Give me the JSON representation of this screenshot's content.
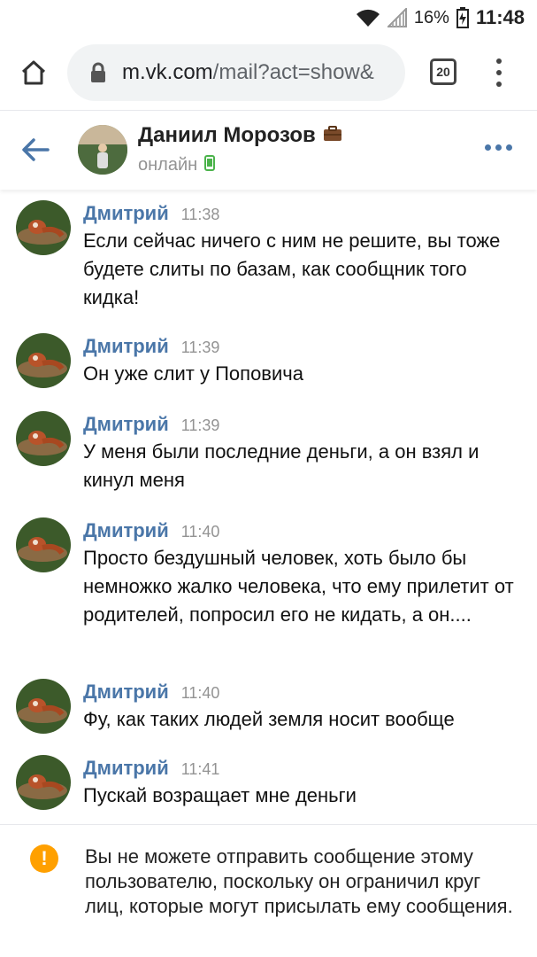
{
  "status_bar": {
    "battery_percent": "16%",
    "time": "11:48"
  },
  "browser": {
    "url_host": "m.vk.com",
    "url_path": "/mail?act=show&",
    "tab_count": "20"
  },
  "chat_header": {
    "name": "Даниил Морозов",
    "status": "онлайн"
  },
  "messages": [
    {
      "author": "Дмитрий",
      "time": "11:38",
      "text": "Если сейчас ничего с ним не решите, вы тоже будете слиты по базам, как сообщник того кидка!"
    },
    {
      "author": "Дмитрий",
      "time": "11:39",
      "text": "Он уже слит у Поповича"
    },
    {
      "author": "Дмитрий",
      "time": "11:39",
      "text": "У меня были последние деньги, а он взял и кинул меня"
    },
    {
      "author": "Дмитрий",
      "time": "11:40",
      "text": "Просто бездушный человек, хоть было бы немножко жалко человека, что ему прилетит от родителей, попросил его не кидать, а он...."
    },
    {
      "author": "Дмитрий",
      "time": "11:40",
      "text": "Фу, как таких людей земля носит вообще"
    },
    {
      "author": "Дмитрий",
      "time": "11:41",
      "text": "Пускай возращает мне деньги"
    }
  ],
  "notice": {
    "icon": "!",
    "text": "Вы не можете отправить сообщение этому пользователю, поскольку он ограничил круг лиц, которые могут присылать ему сообщения."
  },
  "colors": {
    "vk_blue": "#4a76a8",
    "warning": "#ffa000",
    "online_green": "#4bb34b"
  }
}
